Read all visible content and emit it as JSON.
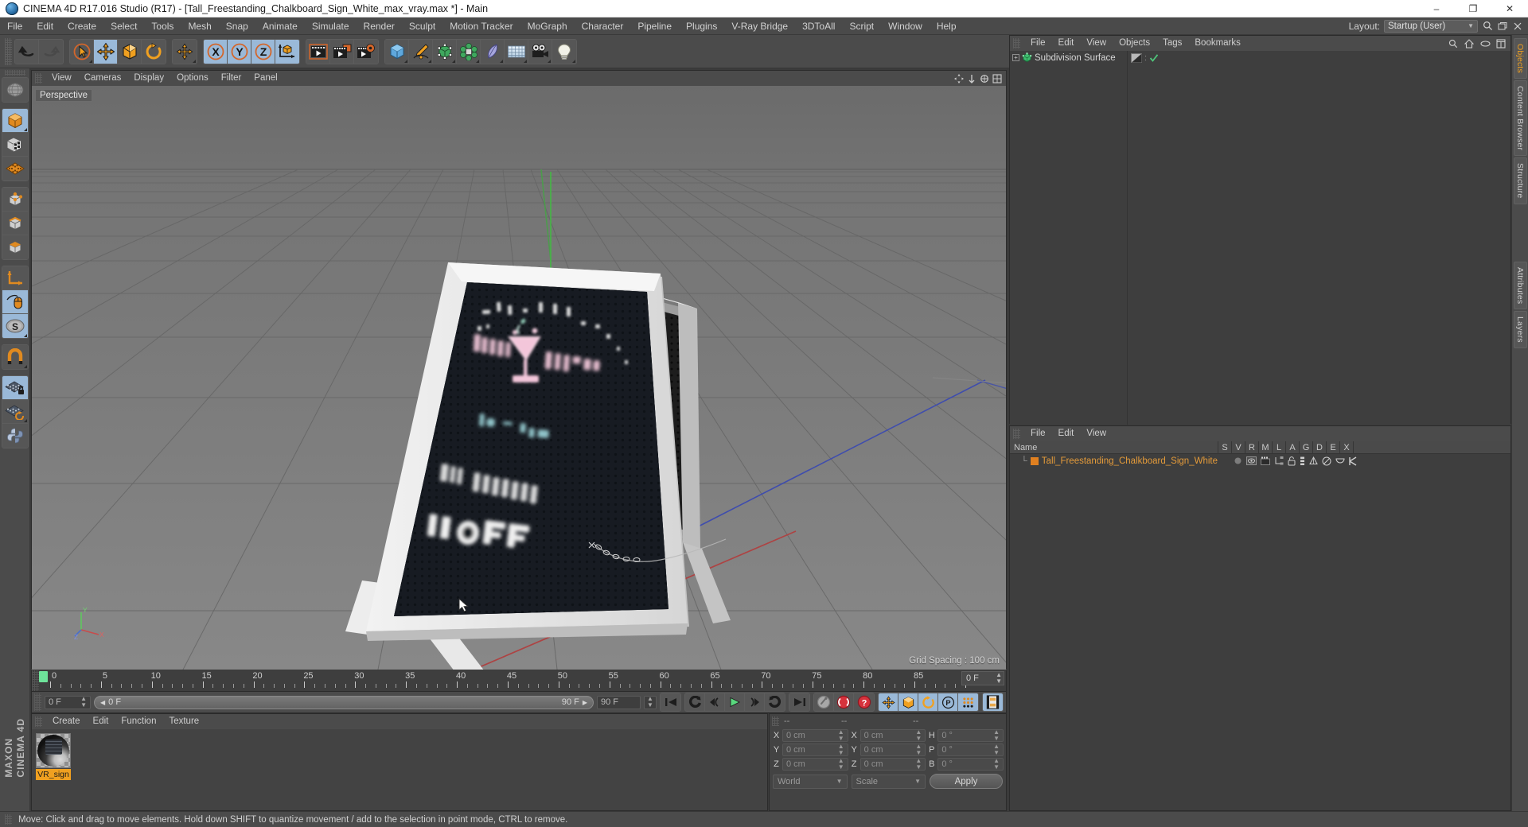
{
  "window": {
    "title": "CINEMA 4D R17.016 Studio (R17) - [Tall_Freestanding_Chalkboard_Sign_White_max_vray.max *] - Main",
    "minimize": "–",
    "maximize": "❐",
    "close": "✕"
  },
  "menubar": {
    "items": [
      "File",
      "Edit",
      "Create",
      "Select",
      "Tools",
      "Mesh",
      "Snap",
      "Animate",
      "Simulate",
      "Render",
      "Sculpt",
      "Motion Tracker",
      "MoGraph",
      "Character",
      "Pipeline",
      "Plugins",
      "V-Ray Bridge",
      "3DToAll",
      "Script",
      "Window",
      "Help"
    ],
    "layout_label": "Layout:",
    "layout_value": "Startup (User)"
  },
  "toolbar": {
    "groups": [
      {
        "name": "history",
        "cells": [
          {
            "icon": "undo-icon",
            "label": "Undo",
            "active": false,
            "dim": false
          },
          {
            "icon": "redo-icon",
            "label": "Redo",
            "active": false,
            "dim": true
          }
        ]
      },
      {
        "name": "transform",
        "cells": [
          {
            "icon": "select-live-icon",
            "label": "Live Selection",
            "active": false,
            "dim": false
          },
          {
            "icon": "move-icon",
            "label": "Move",
            "active": true,
            "dim": false
          },
          {
            "icon": "scale-icon",
            "label": "Scale",
            "active": false,
            "dim": false
          },
          {
            "icon": "rotate-icon",
            "label": "Rotate",
            "active": false,
            "dim": false
          }
        ]
      },
      {
        "name": "move-modes",
        "cells": [
          {
            "icon": "move-alt-icon",
            "label": "Move Mode",
            "active": false,
            "dim": false
          }
        ]
      },
      {
        "name": "axis-locks",
        "cells": [
          {
            "icon": "x-axis-icon",
            "label": "X Axis",
            "active": true,
            "dim": false
          },
          {
            "icon": "y-axis-icon",
            "label": "Y Axis",
            "active": true,
            "dim": false
          },
          {
            "icon": "z-axis-icon",
            "label": "Z Axis",
            "active": true,
            "dim": false
          },
          {
            "icon": "world-object-axis-icon",
            "label": "World / Object Coordinate System",
            "active": false,
            "dim": false
          }
        ]
      },
      {
        "name": "render",
        "cells": [
          {
            "icon": "render-view-icon",
            "label": "Render View",
            "active": false,
            "dim": false
          },
          {
            "icon": "render-picture-viewer-icon",
            "label": "Render to Picture Viewer",
            "active": false,
            "dim": false
          },
          {
            "icon": "render-settings-icon",
            "label": "Edit Render Settings",
            "active": false,
            "dim": false
          }
        ]
      },
      {
        "name": "creation",
        "cells": [
          {
            "icon": "cube-primitive-icon",
            "label": "Add Cube Object",
            "active": false,
            "dim": false
          },
          {
            "icon": "spline-pen-icon",
            "label": "Add Spline",
            "active": false,
            "dim": false
          },
          {
            "icon": "nurbs-generator-icon",
            "label": "Add NURBS Object",
            "active": false,
            "dim": false
          },
          {
            "icon": "array-deformer-icon",
            "label": "Add Modeling Object",
            "active": false,
            "dim": false
          },
          {
            "icon": "bend-deformer-icon",
            "label": "Add Deformation Object",
            "active": false,
            "dim": false
          },
          {
            "icon": "floor-environment-icon",
            "label": "Add Scene Object",
            "active": false,
            "dim": false
          },
          {
            "icon": "camera-icon",
            "label": "Add Camera",
            "active": false,
            "dim": false
          },
          {
            "icon": "light-icon",
            "label": "Add Light",
            "active": false,
            "dim": false
          }
        ]
      }
    ]
  },
  "leftbar": {
    "groups": [
      {
        "cells": [
          {
            "icon": "undo-view-globe-icon",
            "label": "Undo View",
            "active": false
          }
        ]
      },
      {
        "cells": [
          {
            "icon": "model-mode-icon",
            "label": "Model Mode",
            "active": true
          },
          {
            "icon": "texture-mode-icon",
            "label": "Texture Mode",
            "active": false
          },
          {
            "icon": "workplane-mode-icon",
            "label": "Workplane Mode",
            "active": false
          }
        ]
      },
      {
        "cells": [
          {
            "icon": "point-mode-icon",
            "label": "Points Mode",
            "active": false
          },
          {
            "icon": "edge-mode-icon",
            "label": "Edges Mode",
            "active": false
          },
          {
            "icon": "polygon-mode-icon",
            "label": "Polygons Mode",
            "active": false
          }
        ]
      },
      {
        "cells": [
          {
            "icon": "axis-mode-icon",
            "label": "Enable Axis Modification",
            "active": false
          },
          {
            "icon": "object-axis-mouse-icon",
            "label": "Enable Object Axis",
            "active": true
          },
          {
            "icon": "soft-selection-icon",
            "label": "Soft Selection",
            "active": true
          }
        ]
      },
      {
        "cells": [
          {
            "icon": "magnet-icon",
            "label": "Magnet",
            "active": false
          }
        ]
      },
      {
        "cells": [
          {
            "icon": "workplane-lock-icon",
            "label": "Lock Workplane",
            "active": true
          },
          {
            "icon": "workplane-rotate-icon",
            "label": "Rotate Workplane",
            "active": false
          },
          {
            "icon": "python-icon",
            "label": "Python Script",
            "active": false
          }
        ]
      }
    ],
    "brand_line1": "MAXON",
    "brand_line2": "CINEMA 4D"
  },
  "viewport": {
    "menu": [
      "View",
      "Cameras",
      "Display",
      "Options",
      "Filter",
      "Panel"
    ],
    "label": "Perspective",
    "grid_spacing": "Grid Spacing : 100 cm",
    "axis_gizmo": {
      "y": "Y",
      "x": "X",
      "z": "Z"
    },
    "scene": {
      "object": "Tall Freestanding Chalkboard A-Frame Sign (white frame, black chalkboard panel)",
      "board_lines": [
        "HAPPY HOUR",
        "4 - 7 pm",
        "ALL DRINKS",
        "% OFF"
      ]
    }
  },
  "timeline": {
    "ticks": [
      0,
      5,
      10,
      15,
      20,
      25,
      30,
      35,
      40,
      45,
      50,
      55,
      60,
      65,
      70,
      75,
      80,
      85,
      90
    ],
    "current_frame": "0 F",
    "min_frame": "0 F",
    "range_start": "0 F",
    "range_end": "90 F",
    "max_frame": "90 F"
  },
  "animbar": {
    "transport": [
      {
        "icon": "go-to-start-icon",
        "label": "Go to Start"
      },
      {
        "icon": "prev-key-icon",
        "label": "Go to Previous Key"
      },
      {
        "icon": "prev-frame-icon",
        "label": "Go to Previous Frame"
      },
      {
        "icon": "play-icon",
        "label": "Play Forwards"
      },
      {
        "icon": "next-frame-icon",
        "label": "Go to Next Frame"
      },
      {
        "icon": "next-key-icon",
        "label": "Go to Next Key"
      },
      {
        "icon": "go-to-end-icon",
        "label": "Go to End"
      }
    ],
    "record": [
      {
        "icon": "autokey-icon",
        "label": "Autokeying",
        "active": false
      },
      {
        "icon": "record-key-icon",
        "label": "Record Active Objects",
        "active": false
      },
      {
        "icon": "key-selection-icon",
        "label": "Keyframe Selection",
        "active": false
      }
    ],
    "params": [
      {
        "icon": "position-key-icon",
        "label": "Position",
        "active": true
      },
      {
        "icon": "scale-key-icon",
        "label": "Scale",
        "active": true
      },
      {
        "icon": "rotation-key-icon",
        "label": "Rotation",
        "active": true
      },
      {
        "icon": "parameter-key-icon",
        "label": "Parameter",
        "active": true
      },
      {
        "icon": "point-level-anim-icon",
        "label": "Point Level Animation",
        "active": true
      }
    ],
    "extra": [
      {
        "icon": "timeline-filmstrip-icon",
        "label": "Timeline",
        "active": true
      }
    ]
  },
  "material_manager": {
    "menu": [
      "Create",
      "Edit",
      "Function",
      "Texture"
    ],
    "materials": [
      {
        "name": "VR_sign",
        "selected": true
      }
    ]
  },
  "coordinates": {
    "headers": [
      "--",
      "--",
      "--"
    ],
    "rows": [
      {
        "label1": "X",
        "value1": "0 cm",
        "label2": "X",
        "value2": "0 cm",
        "label3": "H",
        "value3": "0 °"
      },
      {
        "label1": "Y",
        "value1": "0 cm",
        "label2": "Y",
        "value2": "0 cm",
        "label3": "P",
        "value3": "0 °"
      },
      {
        "label1": "Z",
        "value1": "0 cm",
        "label2": "Z",
        "value2": "0 cm",
        "label3": "B",
        "value3": "0 °"
      }
    ],
    "system": "World",
    "mode": "Scale",
    "apply": "Apply"
  },
  "object_manager": {
    "menu": [
      "File",
      "Edit",
      "View",
      "Objects",
      "Tags",
      "Bookmarks"
    ],
    "header_icons": [
      "search-icon",
      "home-icon",
      "eye-icon",
      "fit-icon"
    ],
    "rows": [
      {
        "name": "Subdivision Surface",
        "expandable": true,
        "icon": "subdivision-surface-icon",
        "tags": [
          "render-tag",
          "checkmark-tag"
        ]
      }
    ]
  },
  "layer_manager": {
    "menu": [
      "File",
      "Edit",
      "View"
    ],
    "columns": [
      "Name",
      "S",
      "V",
      "R",
      "M",
      "L",
      "A",
      "G",
      "D",
      "E",
      "X"
    ],
    "rows": [
      {
        "name": "Tall_Freestanding_Chalkboard_Sign_White",
        "color": "#e08020"
      }
    ]
  },
  "right_tabs": [
    {
      "label": "Objects",
      "accent": true
    },
    {
      "label": "Content Browser",
      "accent": false
    },
    {
      "label": "Structure",
      "accent": false
    },
    {
      "label": "Attributes",
      "accent": false
    },
    {
      "label": "Layers",
      "accent": false
    }
  ],
  "statusbar": {
    "text": "Move: Click and drag to move elements. Hold down SHIFT to quantize movement / add to the selection in point mode, CTRL to remove."
  },
  "colors": {
    "chrome": "#4b4b4b",
    "panel": "#3e3e3e",
    "accent_orange": "#f0a020",
    "active_blue": "#9ab9d8",
    "axis_green": "#5ec85e",
    "axis_red": "#c84b4b",
    "axis_blue": "#4b5ec8"
  }
}
